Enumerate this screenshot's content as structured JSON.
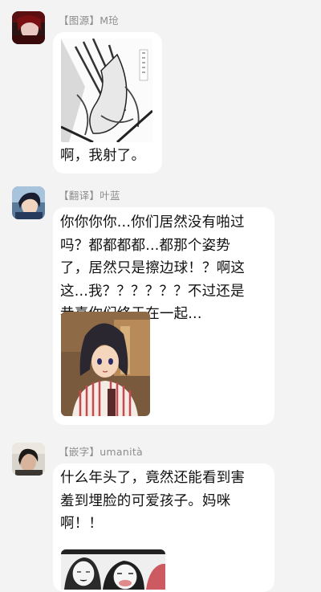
{
  "messages": [
    {
      "tag": "【图源】",
      "author": "M玱",
      "text_lines": [
        "啊，我射了。"
      ],
      "image": "manga-panel-image"
    },
    {
      "tag": "【翻译】",
      "author": "叶蓝",
      "text_lines": [
        "你你你你...你们居然没有啪过",
        "吗？都都都都...都那个姿势",
        "了，居然只是擦边球！？啊这",
        "这...我？？？？？？不过还是",
        "恭喜你们终于在一起..."
      ],
      "image": "anime-girl-image"
    },
    {
      "tag": "【嵌字】",
      "author": "umanità",
      "text_lines": [
        "什么年头了，竟然还能看到害",
        "羞到埋脸的可爱孩子。妈咪",
        "啊！！"
      ],
      "image": "manga-faces-image"
    }
  ],
  "colors": {
    "background": "#f3f3f3",
    "bubble": "#ffffff",
    "name_text": "#8c8c8c",
    "message_text": "#111111"
  }
}
